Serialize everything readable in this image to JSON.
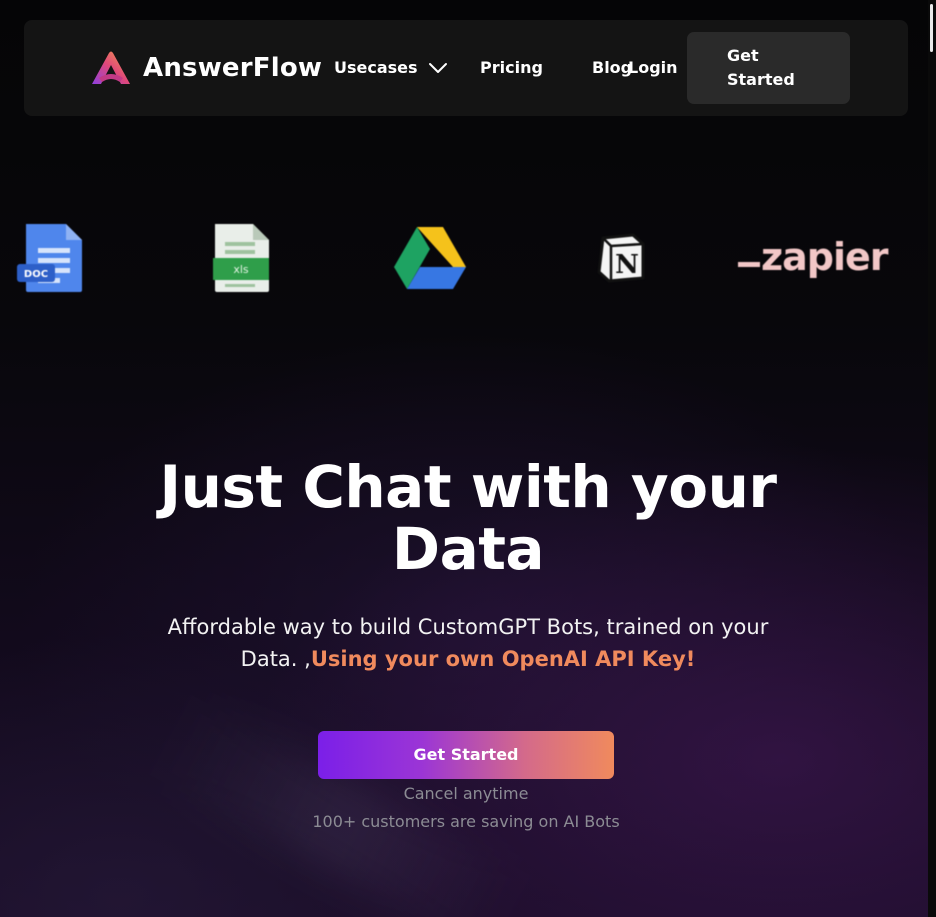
{
  "brand": {
    "name": "AnswerFlow"
  },
  "nav": {
    "usecases": "Usecases",
    "pricing": "Pricing",
    "blog": "Blog",
    "login": "Login",
    "cta_line1": "Get",
    "cta_line2": "Started"
  },
  "integrations": {
    "doc_label": "DOC",
    "xls_label": "xls",
    "notion_label": "N",
    "zapier_label": "zapier"
  },
  "hero": {
    "title_line1": "Just Chat with your",
    "title_line2": "Data",
    "subtitle_part1": "Affordable way to build CustomGPT Bots, trained on your Data. ,",
    "subtitle_accent": "Using your own OpenAI API Key!",
    "cta": "Get Started",
    "cancel_note": "Cancel anytime",
    "customers_note": "100+ customers are saving on AI Bots"
  },
  "colors": {
    "accent": "#f08a5d",
    "cta_gradient_start": "#7b1fe8",
    "cta_gradient_end": "#f08a5d",
    "nav_bg": "#141414"
  }
}
